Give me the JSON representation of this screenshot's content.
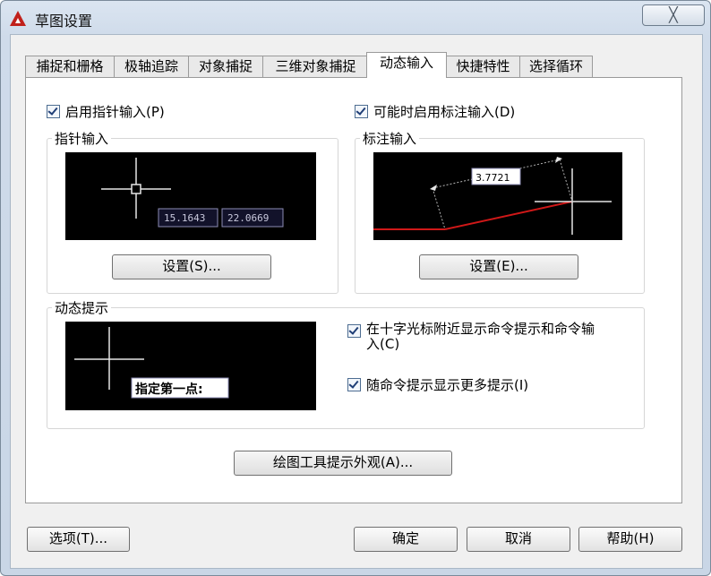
{
  "window": {
    "title": "草图设置",
    "close_glyph": "╳"
  },
  "tabs": [
    {
      "label": "捕捉和栅格"
    },
    {
      "label": "极轴追踪"
    },
    {
      "label": "对象捕捉"
    },
    {
      "label": "三维对象捕捉"
    },
    {
      "label": "动态输入",
      "active": true
    },
    {
      "label": "快捷特性"
    },
    {
      "label": "选择循环"
    }
  ],
  "pointer": {
    "enable_label": "启用指针输入(P)",
    "enable_checked": true,
    "group_title": "指针输入",
    "preview_values": [
      "15.1643",
      "22.0669"
    ],
    "settings_button": "设置(S)..."
  },
  "dimension": {
    "enable_label": "可能时启用标注输入(D)",
    "enable_checked": true,
    "group_title": "标注输入",
    "preview_value": "3.7721",
    "settings_button": "设置(E)..."
  },
  "dynamic_prompts": {
    "group_title": "动态提示",
    "preview_text": "指定第一点:",
    "show_prompts_line1": "在十字光标附近显示命令提示和命令输",
    "show_prompts_line2": "入(C)",
    "show_prompts_checked": true,
    "more_prompts_label": "随命令提示显示更多提示(I)",
    "more_prompts_checked": true
  },
  "tooltip_appearance_button": "绘图工具提示外观(A)...",
  "footer": {
    "options": "选项(T)...",
    "ok": "确定",
    "cancel": "取消",
    "help": "帮助(H)"
  },
  "colors": {
    "preview_bg": "#000000",
    "crosshair": "#e6e6e6",
    "dim_line": "#d01818",
    "tooltip_border": "#8c8cb4"
  }
}
